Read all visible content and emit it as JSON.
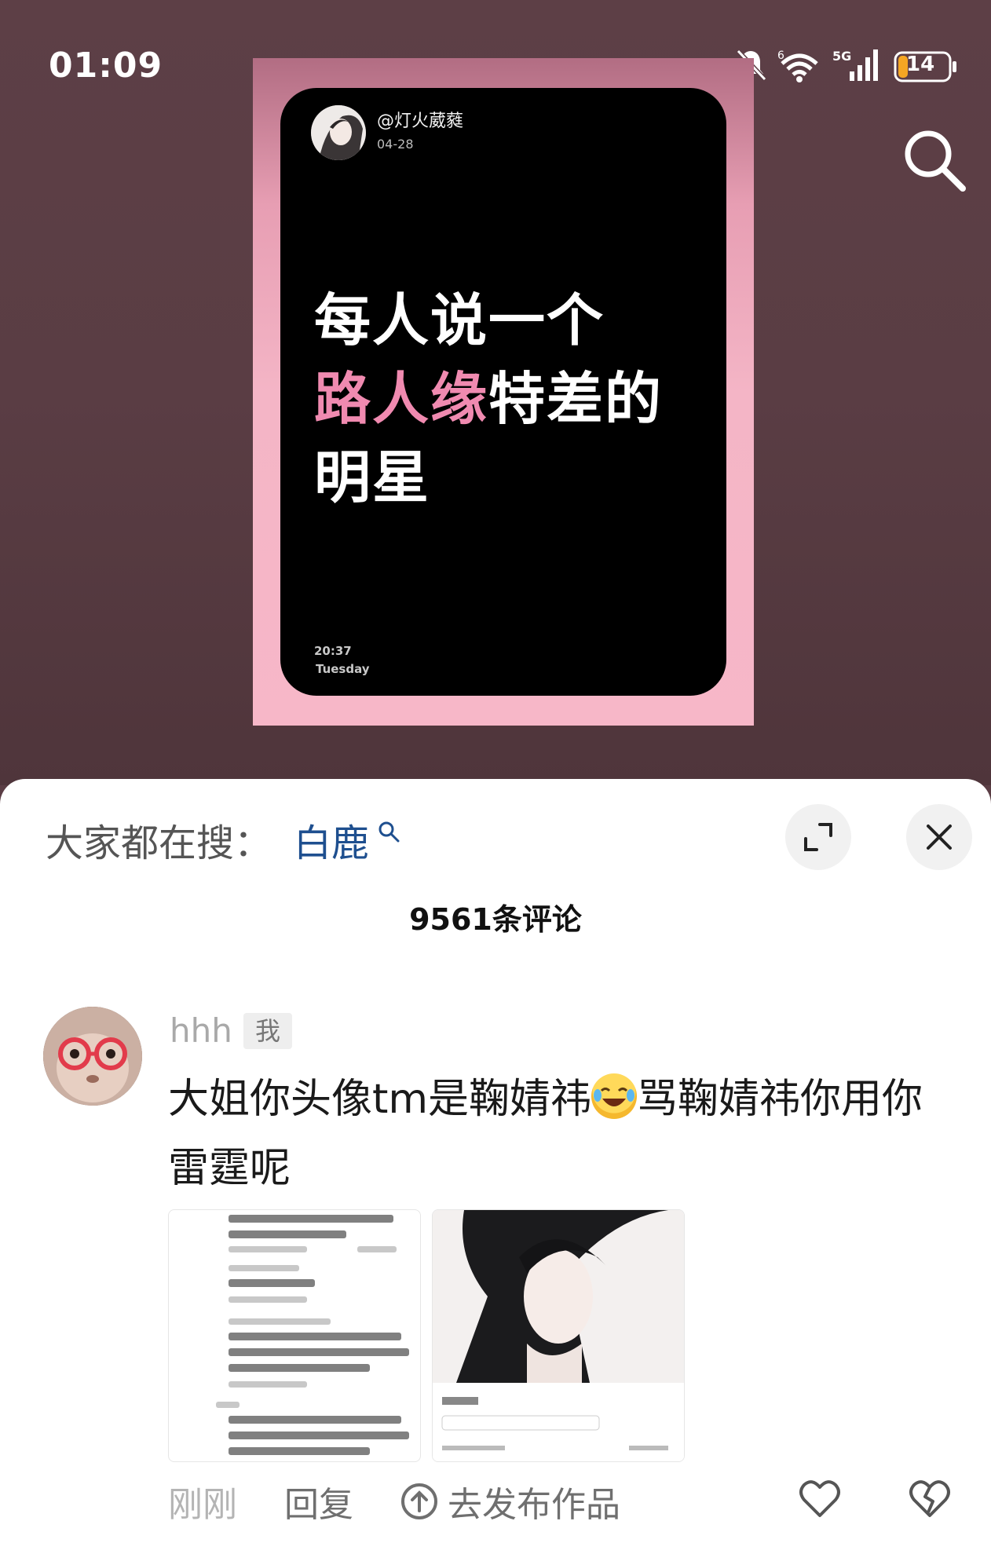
{
  "status_bar": {
    "time": "01:09",
    "battery": "14",
    "network": "5G",
    "icons": [
      "mute-icon",
      "wifi-icon",
      "signal-icon",
      "battery-icon"
    ]
  },
  "post": {
    "username": "@灯火葳蕤",
    "date": "04-28",
    "line1": "每人说一个",
    "line2_highlight": "路人缘",
    "line2_rest": "特差的",
    "line3": "明星",
    "time": "20:37",
    "weekday": "Tuesday",
    "accent_color": "#f08ab0"
  },
  "sheet": {
    "trending_prefix": "大家都在搜：",
    "trending_term": "白鹿",
    "comments_count": "9561条评论"
  },
  "comment": {
    "username": "hhh",
    "badge": "我",
    "text_line1_a": "大姐你头像tm是鞠婧祎",
    "text_line1_b": "骂鞠婧祎你用你",
    "text_line2": "雷霆呢",
    "time": "刚刚",
    "reply": "回复",
    "publish": "去发布作品"
  },
  "colors": {
    "link_blue": "#1e4f8f",
    "bg_dark": "#5b3e45"
  }
}
